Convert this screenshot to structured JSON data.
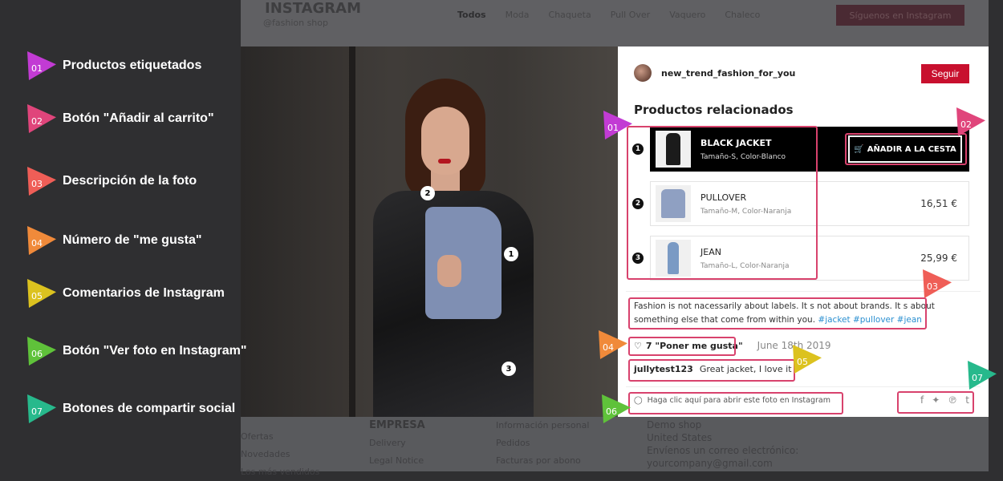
{
  "background": {
    "brand": "INSTAGRAM",
    "handle": "@fashion shop",
    "filters": [
      "Todos",
      "Moda",
      "Chaqueta",
      "Pull Over",
      "Vaquero",
      "Chaleco"
    ],
    "follow_label": "Síguenos en Instagram",
    "footer": {
      "col1": [
        "Ofertas",
        "Novedades",
        "Los más vendidos"
      ],
      "col2_title": "EMPRESA",
      "col2": [
        "Delivery",
        "Legal Notice"
      ],
      "col3": [
        "Información personal",
        "Pedidos",
        "Facturas por abono"
      ],
      "col4": [
        "Demo shop",
        "United States",
        "Envíenos un correo electrónico:",
        "yourcompany@gmail.com"
      ]
    }
  },
  "legend": [
    {
      "num": "01",
      "label": "Productos etiquetados",
      "color": "#c23bd4"
    },
    {
      "num": "02",
      "label": "Botón \"Añadir al carrito\"",
      "color": "#e0457b"
    },
    {
      "num": "03",
      "label": "Descripción de la foto",
      "color": "#ef5e57"
    },
    {
      "num": "04",
      "label": "Número de \"me gusta\"",
      "color": "#f08a3a"
    },
    {
      "num": "05",
      "label": "Comentarios de Instagram",
      "color": "#dcc21f"
    },
    {
      "num": "06",
      "label": "Botón \"Ver foto en Instagram\"",
      "color": "#5fc23a"
    },
    {
      "num": "07",
      "label": "Botones de compartir social",
      "color": "#27b98c"
    }
  ],
  "post": {
    "username": "new_trend_fashion_for_you",
    "follow_button": "Seguir",
    "related_title": "Productos relacionados",
    "products": [
      {
        "num": "1",
        "name": "BLACK JACKET",
        "detail": "Tamaño-S, Color-Blanco",
        "price": "",
        "active": true
      },
      {
        "num": "2",
        "name": "PULLOVER",
        "detail": "Tamaño-M, Color-Naranja",
        "price": "16,51 €",
        "active": false
      },
      {
        "num": "3",
        "name": "JEAN",
        "detail": "Tamaño-L, Color-Naranja",
        "price": "25,99 €",
        "active": false
      }
    ],
    "cart_button": "AÑADIR A LA CESTA",
    "description": "Fashion is not nacessarily about labels. It s not about brands. It s about something else that come from within you.",
    "tags": "#jacket #pullover #jean",
    "likes": "7 \"Poner me gusta\"",
    "date": "June 18th 2019",
    "comment_user": "jullytest123",
    "comment_text": "Great jacket, I love it",
    "instagram_link": "Haga clic aquí para abrir este foto en Instagram",
    "social_icons": [
      "facebook-icon",
      "twitter-icon",
      "pinterest-icon",
      "tumblr-icon"
    ]
  },
  "hotspots": [
    "1",
    "2",
    "3"
  ]
}
